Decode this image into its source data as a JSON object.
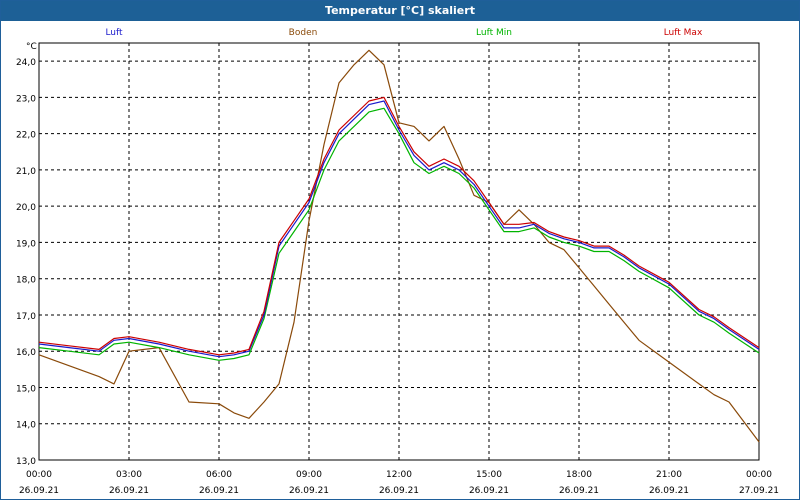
{
  "window": {
    "title": "Temperatur [°C] skaliert"
  },
  "chart_data": {
    "type": "line",
    "title": "Temperatur [°C] skaliert",
    "ylabel": "°C",
    "ylim": [
      13.0,
      24.5
    ],
    "yticks": [
      "13,0",
      "14,0",
      "15,0",
      "16,0",
      "17,0",
      "18,0",
      "19,0",
      "20,0",
      "21,0",
      "22,0",
      "23,0",
      "24,0"
    ],
    "xlim": [
      "2021-09-26 00:00",
      "2021-09-27 00:00"
    ],
    "xticks": [
      {
        "time": "00:00",
        "date": "26.09.21"
      },
      {
        "time": "03:00",
        "date": "26.09.21"
      },
      {
        "time": "06:00",
        "date": "26.09.21"
      },
      {
        "time": "09:00",
        "date": "26.09.21"
      },
      {
        "time": "12:00",
        "date": "26.09.21"
      },
      {
        "time": "15:00",
        "date": "26.09.21"
      },
      {
        "time": "18:00",
        "date": "26.09.21"
      },
      {
        "time": "21:00",
        "date": "26.09.21"
      },
      {
        "time": "00:00",
        "date": "27.09.21"
      }
    ],
    "grid": true,
    "x_hours": [
      0,
      1,
      2,
      2.5,
      3,
      4,
      5,
      6,
      6.5,
      7,
      7.5,
      8,
      8.5,
      9,
      9.5,
      10,
      10.5,
      11,
      11.5,
      12,
      12.5,
      13,
      13.5,
      14,
      14.5,
      15,
      15.5,
      16,
      16.5,
      17,
      17.5,
      18,
      18.5,
      19,
      19.5,
      20,
      21,
      22,
      22.5,
      23,
      24
    ],
    "series": [
      {
        "name": "Luft",
        "color": "#1a1acc",
        "values": [
          16.2,
          16.1,
          16.0,
          16.3,
          16.35,
          16.2,
          16.0,
          15.85,
          15.9,
          16.0,
          17.0,
          18.9,
          19.5,
          20.1,
          21.2,
          22.0,
          22.4,
          22.8,
          22.9,
          22.1,
          21.4,
          21.0,
          21.2,
          21.0,
          20.6,
          20.0,
          19.4,
          19.4,
          19.5,
          19.25,
          19.1,
          19.0,
          18.85,
          18.85,
          18.6,
          18.3,
          17.85,
          17.1,
          16.9,
          16.6,
          16.05
        ]
      },
      {
        "name": "Boden",
        "color": "#8a4a0a",
        "values": [
          15.9,
          15.6,
          15.3,
          15.1,
          16.0,
          16.1,
          14.6,
          14.55,
          14.3,
          14.15,
          14.6,
          15.1,
          16.8,
          19.6,
          21.7,
          23.4,
          23.9,
          24.3,
          23.9,
          22.3,
          22.2,
          21.8,
          22.2,
          21.3,
          20.3,
          20.1,
          19.5,
          19.9,
          19.5,
          19.0,
          18.8,
          18.3,
          17.8,
          17.3,
          16.8,
          16.3,
          15.7,
          15.1,
          14.8,
          14.6,
          13.5
        ]
      },
      {
        "name": "Luft Min",
        "color": "#00b400",
        "values": [
          16.1,
          16.0,
          15.9,
          16.2,
          16.25,
          16.1,
          15.9,
          15.75,
          15.8,
          15.9,
          16.9,
          18.7,
          19.3,
          19.9,
          21.0,
          21.8,
          22.2,
          22.6,
          22.7,
          22.0,
          21.2,
          20.9,
          21.1,
          20.9,
          20.5,
          19.9,
          19.3,
          19.3,
          19.4,
          19.15,
          19.0,
          18.9,
          18.75,
          18.75,
          18.5,
          18.2,
          17.75,
          17.0,
          16.8,
          16.5,
          15.95
        ]
      },
      {
        "name": "Luft Max",
        "color": "#cc0000",
        "values": [
          16.25,
          16.15,
          16.05,
          16.35,
          16.4,
          16.25,
          16.05,
          15.9,
          15.95,
          16.05,
          17.1,
          19.0,
          19.6,
          20.2,
          21.3,
          22.1,
          22.5,
          22.9,
          23.0,
          22.2,
          21.5,
          21.1,
          21.3,
          21.1,
          20.7,
          20.1,
          19.5,
          19.5,
          19.55,
          19.3,
          19.15,
          19.05,
          18.9,
          18.9,
          18.65,
          18.35,
          17.9,
          17.15,
          16.95,
          16.65,
          16.1
        ]
      }
    ]
  }
}
